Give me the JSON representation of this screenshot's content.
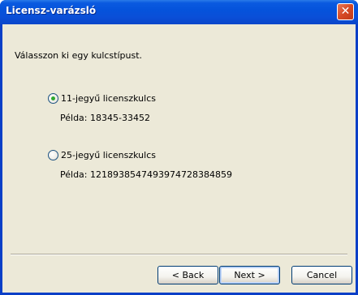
{
  "window": {
    "title": "Licensz-varázsló",
    "close_symbol": "✕"
  },
  "prompt": "Válasszon ki egy kulcstípust.",
  "options": [
    {
      "label": "11-jegyű licenszkulcs",
      "example": "Példa: 18345-33452",
      "checked": true
    },
    {
      "label": "25-jegyű licenszkulcs",
      "example": "Példa: 1218938547493974728384859",
      "checked": false
    }
  ],
  "buttons": {
    "back": "< Back",
    "next": "Next >",
    "cancel": "Cancel"
  }
}
